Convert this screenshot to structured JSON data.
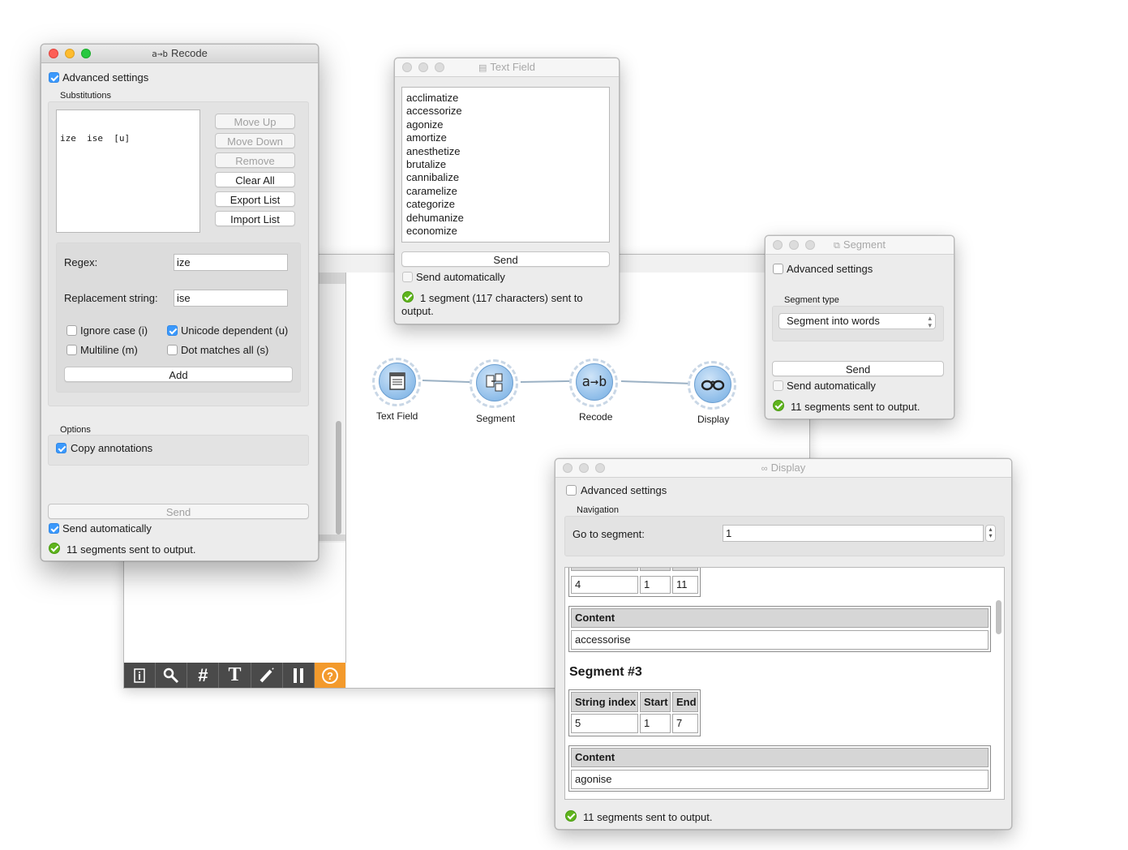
{
  "canvas": {
    "nodes": [
      {
        "label": "Text Field",
        "icon": "text-document-icon"
      },
      {
        "label": "Segment",
        "icon": "segment-icon"
      },
      {
        "label": "Recode",
        "icon": "recode-icon"
      },
      {
        "label": "Display",
        "icon": "glasses-icon"
      }
    ],
    "toolbar": [
      "info-icon",
      "search-icon",
      "grid-icon",
      "text-tool-icon",
      "brush-icon",
      "pause-icon",
      "help-icon"
    ]
  },
  "recode": {
    "title": "Recode",
    "advanced_settings": "Advanced settings",
    "substitutions_label": "Substitutions",
    "substitution_row": "ize  ise  [u]",
    "buttons": {
      "move_up": "Move Up",
      "move_down": "Move Down",
      "remove": "Remove",
      "clear_all": "Clear All",
      "export": "Export List",
      "import": "Import List"
    },
    "regex_label": "Regex:",
    "regex_value": "ize",
    "replacement_label": "Replacement string:",
    "replacement_value": "ise",
    "ignore_case": "Ignore case (i)",
    "unicode": "Unicode dependent (u)",
    "multiline": "Multiline (m)",
    "dot_all": "Dot matches all (s)",
    "add": "Add",
    "options_label": "Options",
    "copy_annotations": "Copy annotations",
    "send": "Send",
    "send_auto": "Send automatically",
    "status": "11 segments sent to output."
  },
  "textfield": {
    "title": "Text Field",
    "words": [
      "acclimatize",
      "accessorize",
      "agonize",
      "amortize",
      "anesthetize",
      "brutalize",
      "cannibalize",
      "caramelize",
      "categorize",
      "dehumanize",
      "economize"
    ],
    "send": "Send",
    "send_auto": "Send automatically",
    "status_line1": "1 segment (117 characters) sent to",
    "status_line2": "output."
  },
  "segment": {
    "title": "Segment",
    "advanced_settings": "Advanced settings",
    "segment_type_label": "Segment type",
    "segment_type_value": "Segment into words",
    "send": "Send",
    "send_auto": "Send automatically",
    "status": "11 segments sent to output."
  },
  "display": {
    "title": "Display",
    "advanced_settings": "Advanced settings",
    "navigation_label": "Navigation",
    "goto_label": "Go to segment:",
    "goto_value": "1",
    "partial_row": [
      "4",
      "1",
      "11"
    ],
    "content_header": "Content",
    "content1": "accessorise",
    "segment3_title": "Segment #3",
    "headers": [
      "String index",
      "Start",
      "End"
    ],
    "row3": [
      "5",
      "1",
      "7"
    ],
    "content2_header": "Content",
    "content2": "agonise",
    "status": "11 segments sent to output."
  }
}
